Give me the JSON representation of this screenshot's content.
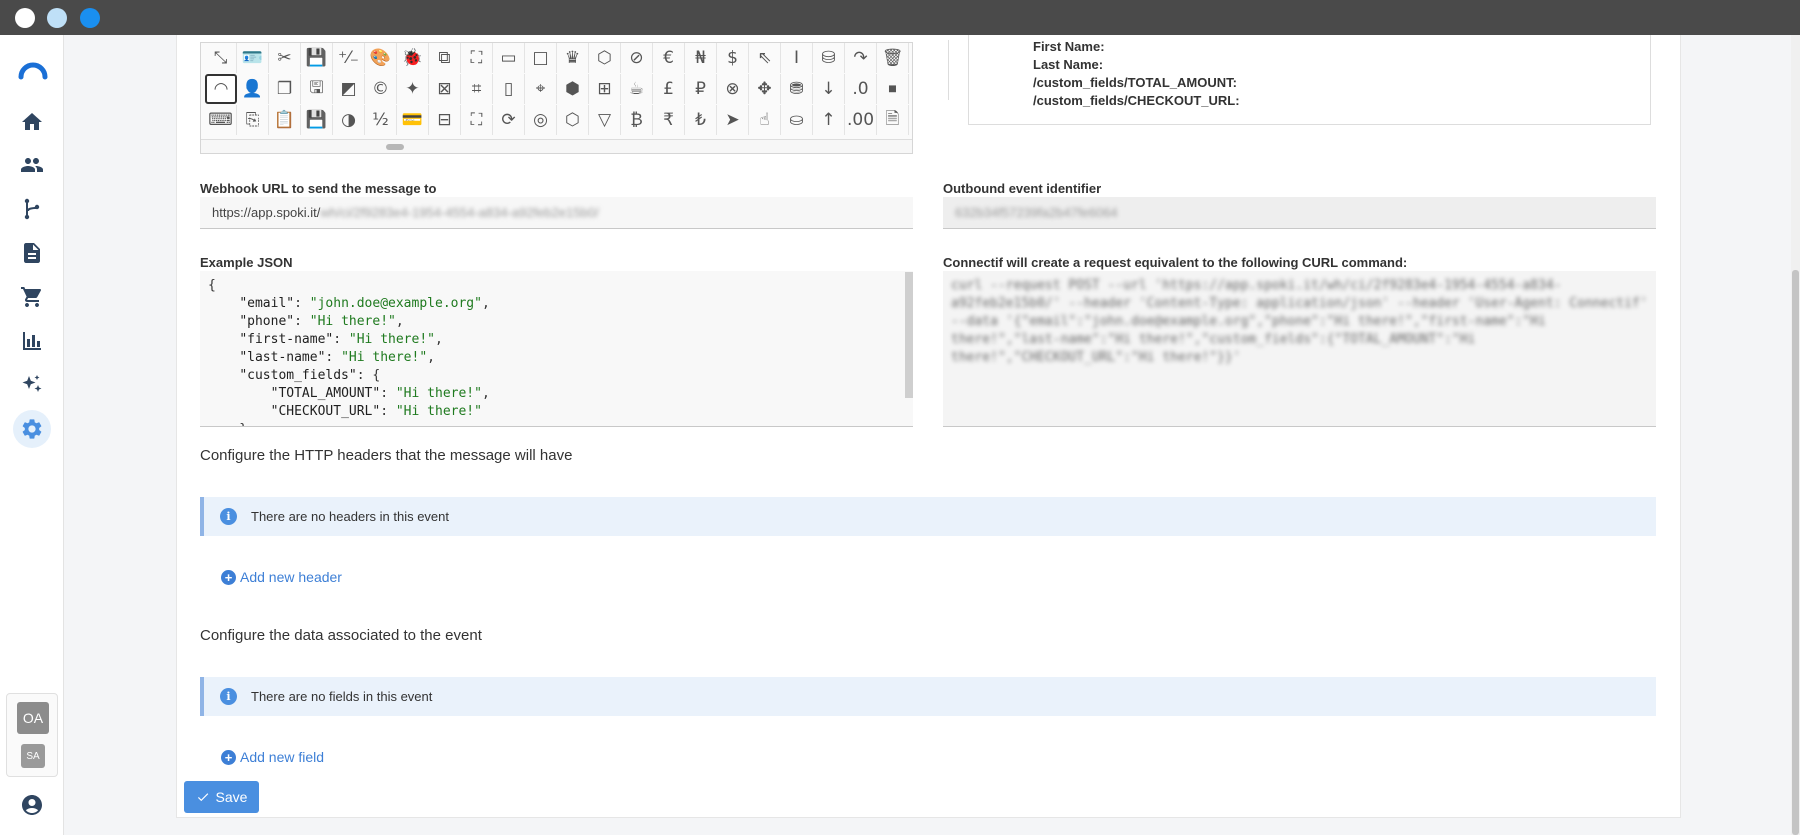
{
  "preview": {
    "lines": [
      "First Name:",
      "Last Name:",
      "/custom_fields/TOTAL_AMOUNT:",
      "/custom_fields/CHECKOUT_URL:"
    ]
  },
  "webhook": {
    "label": "Webhook URL to send the message to",
    "value_visible": "https://app.spoki.it/",
    "value_blurred": "wh/ci/2f9283e4-1954-4554-a834-a92feb2e15b0/"
  },
  "outbound": {
    "label": "Outbound event identifier",
    "value_blurred": "632b34f57239fa2b47fe6064"
  },
  "example_json": {
    "label": "Example JSON",
    "lines": [
      "{",
      "    \"email\": \"john.doe@example.org\",",
      "    \"phone\": \"Hi there!\",",
      "    \"first-name\": \"Hi there!\",",
      "    \"last-name\": \"Hi there!\",",
      "    \"custom_fields\": {",
      "        \"TOTAL_AMOUNT\": \"Hi there!\",",
      "        \"CHECKOUT_URL\": \"Hi there!\"",
      "    }"
    ]
  },
  "curl": {
    "label": "Connectif will create a request equivalent to the following CURL command:",
    "text_blurred": "curl --request POST --url 'https://app.spoki.it/wh/ci/2f9283e4-1954-4554-a834-a92feb2e15b0/' --header 'Content-Type: application/json' --header 'User-Agent: Connectif' --data '{\"email\":\"john.doe@example.org\",\"phone\":\"Hi there!\",\"first-name\":\"Hi there!\",\"last-name\":\"Hi there!\",\"custom_fields\":{\"TOTAL_AMOUNT\":\"Hi there!\",\"CHECKOUT_URL\":\"Hi there!\"}}'"
  },
  "headers_section": {
    "title": "Configure the HTTP headers that the message will have",
    "info": "There are no headers in this event",
    "add_label": "Add new header"
  },
  "data_section": {
    "title": "Configure the data associated to the event",
    "info": "There are no fields in this event",
    "add_label": "Add new field"
  },
  "save_label": "Save",
  "avatars": {
    "primary": "OA",
    "secondary": "SA"
  },
  "colors": {
    "accent": "#4a8fe0",
    "sidebar_icon": "#2f4560",
    "info_bg": "#eaf2fb"
  },
  "icons": {
    "sidebar": [
      "home-icon",
      "people-icon",
      "workflow-icon",
      "document-icon",
      "cart-icon",
      "chart-icon",
      "sparkles-icon",
      "gear-icon"
    ]
  }
}
